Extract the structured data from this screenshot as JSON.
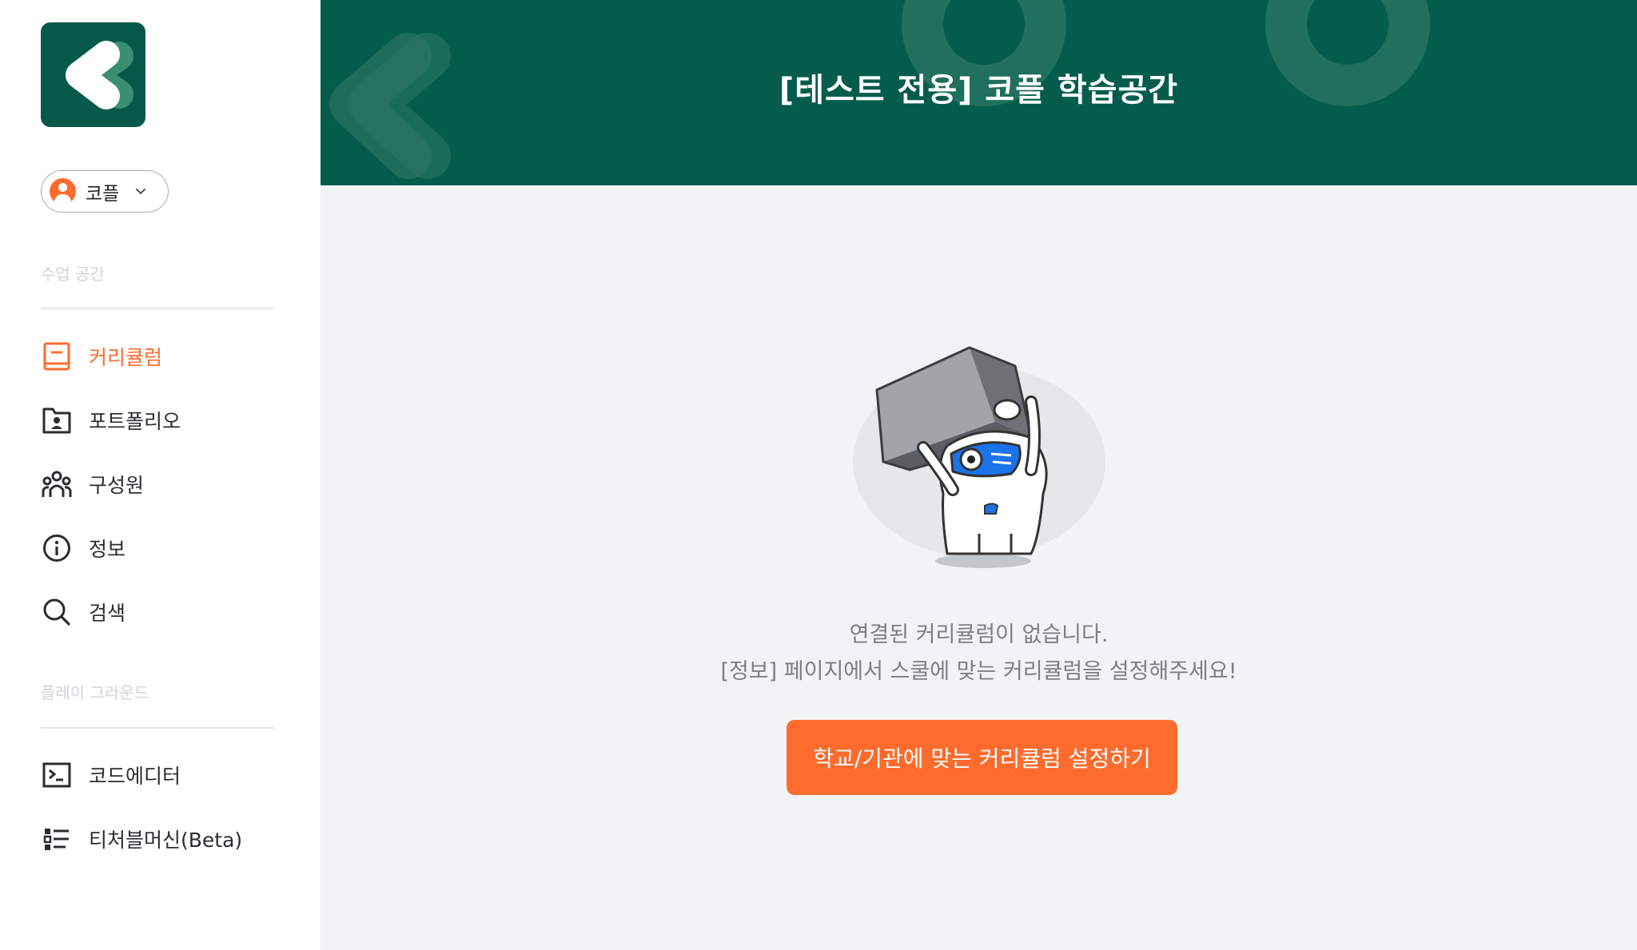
{
  "sidebar": {
    "user": {
      "name": "코플"
    },
    "section1_label": "수업 공간",
    "section2_label": "플레이 그라운드",
    "class_items": [
      {
        "label": "커리큘럼",
        "icon": "book-icon",
        "active": true
      },
      {
        "label": "포트폴리오",
        "icon": "portfolio-icon",
        "active": false
      },
      {
        "label": "구성원",
        "icon": "members-icon",
        "active": false
      },
      {
        "label": "정보",
        "icon": "info-icon",
        "active": false
      },
      {
        "label": "검색",
        "icon": "search-icon",
        "active": false
      }
    ],
    "play_items": [
      {
        "label": "코드에디터",
        "icon": "terminal-icon"
      },
      {
        "label": "티처블머신(Beta)",
        "icon": "list-icon"
      }
    ]
  },
  "header": {
    "title": "[테스트 전용] 코플 학습공간"
  },
  "empty_state": {
    "line1": "연결된 커리큘럼이 없습니다.",
    "line2": "[정보] 페이지에서 스쿨에 맞는 커리큘럼을 설정해주세요!",
    "button_label": "학교/기관에 맞는 커리큘럼 설정하기"
  },
  "colors": {
    "brand_green": "#045c4c",
    "accent_orange": "#ff6b2c",
    "background": "#f2f3f4"
  }
}
